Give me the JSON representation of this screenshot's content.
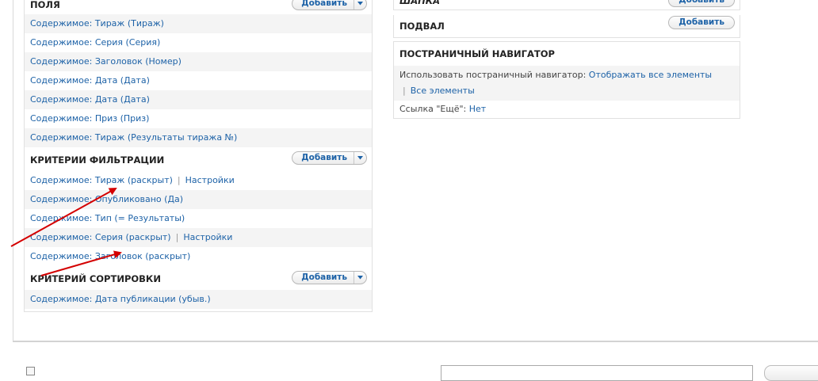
{
  "left": {
    "fields": {
      "title": "ПОЛЯ",
      "add_label": "Добавить",
      "items": [
        "Содержимое: Тираж (Тираж)",
        "Содержимое: Серия (Серия)",
        "Содержимое: Заголовок (Номер)",
        "Содержимое: Дата (Дата)",
        "Содержимое: Дата (Дата)",
        "Содержимое: Приз (Приз)",
        "Содержимое: Тираж (Результаты тиража №)"
      ]
    },
    "filters": {
      "title": "КРИТЕРИИ ФИЛЬТРАЦИИ",
      "add_label": "Добавить",
      "items": [
        {
          "text": "Содержимое: Тираж (раскрыт)",
          "settings": "Настройки"
        },
        {
          "text": "Содержимое: Опубликовано (Да)"
        },
        {
          "text": "Содержимое: Тип (= Результаты)"
        },
        {
          "text": "Содержимое: Серия (раскрыт)",
          "settings": "Настройки"
        },
        {
          "text": "Содержимое: Заголовок (раскрыт)"
        }
      ]
    },
    "sort": {
      "title": "КРИТЕРИЙ СОРТИРОВКИ",
      "add_label": "Добавить",
      "items": [
        "Содержимое: Дата публикации (убыв.)"
      ]
    }
  },
  "right": {
    "header": {
      "title": "ШАПКА",
      "add_label": "Добавить"
    },
    "footer": {
      "title": "ПОДВАЛ",
      "add_label": "Добавить"
    },
    "pager": {
      "title": "ПОСТРАНИЧНЫЙ НАВИГАТОР",
      "use_label": "Использовать постраничный навигатор:",
      "use_value": "Отображать все элементы",
      "sep": "|",
      "all_items": "Все элементы",
      "more_label": "Ссылка \"Ещё\":",
      "more_value": "Нет"
    }
  },
  "colors": {
    "link": "#1d62a7",
    "arrow": "#d40000"
  }
}
